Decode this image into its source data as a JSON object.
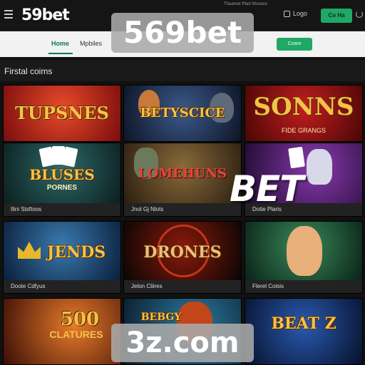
{
  "header": {
    "logo": "59bet",
    "top_note": "Thaamet Ptarl Wsoans",
    "login_label": "Logo",
    "cta_label": "Co Ha"
  },
  "subnav": {
    "tabs": [
      "Home",
      "Mpbiles"
    ],
    "active_tab": "Home",
    "cta_label": "Coare"
  },
  "section": {
    "title": "Firstal coims"
  },
  "games": [
    {
      "title": "TUPSNES",
      "sub": "",
      "caption": ""
    },
    {
      "title": "BETYSCICE",
      "sub": "",
      "caption": ""
    },
    {
      "title": "SONNS",
      "sub": "FIDE GRANGS",
      "caption": ""
    },
    {
      "title": "BLUSES",
      "sub": "PORNES",
      "caption": "Ilini Stsftoos"
    },
    {
      "title": "LOMEHUNS",
      "sub": "",
      "caption": "Jnol Gj Nlots"
    },
    {
      "title": "",
      "sub": "",
      "caption": "Dotie Plaris"
    },
    {
      "title": "JENDS",
      "sub": "",
      "caption": "Doote Cdfyus"
    },
    {
      "title": "DRONES",
      "sub": "",
      "caption": "Jelon Cliires"
    },
    {
      "title": "",
      "sub": "",
      "caption": "Flerel Coisis"
    },
    {
      "title": "500",
      "sub": "CLATURES",
      "caption": ""
    },
    {
      "title": "BEBGY",
      "sub": "",
      "caption": ""
    },
    {
      "title": "BEAT Z",
      "sub": "",
      "caption": ""
    }
  ],
  "watermarks": {
    "top": "569bet",
    "bottom": "3z.com",
    "mid": "BET"
  },
  "colors": {
    "accent": "#1fa866",
    "header_bg": "#151515"
  }
}
